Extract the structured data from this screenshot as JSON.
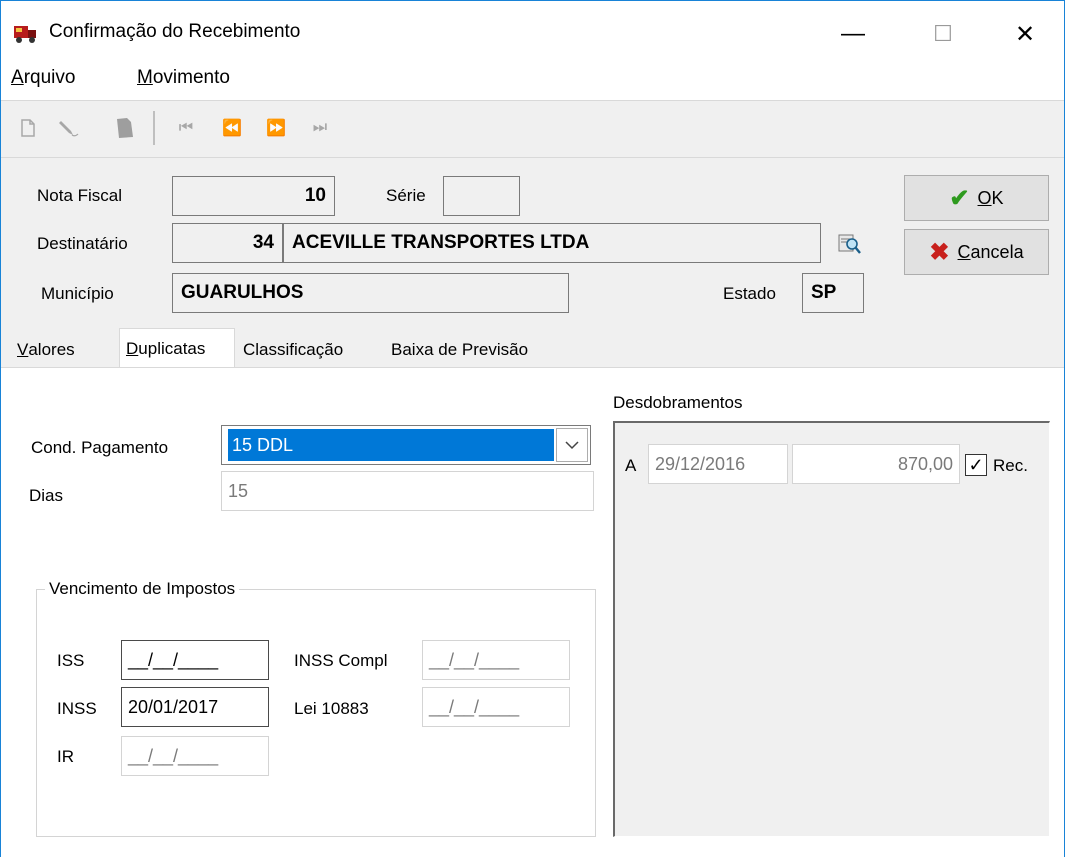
{
  "window": {
    "title": "Confirmação do Recebimento",
    "minimize": "—",
    "maximize": "☐",
    "close": "✕"
  },
  "menu": {
    "arquivo": {
      "ul": "A",
      "rest": "rquivo"
    },
    "movimento": {
      "ul": "M",
      "rest": "ovimento"
    }
  },
  "toolbar": {
    "icons": [
      "new-document-icon",
      "edit-pencil-icon",
      "delete-icon",
      "first-record-icon",
      "prev-record-icon",
      "next-record-icon",
      "last-record-icon"
    ],
    "first": "⏮",
    "prev": "⏪",
    "next": "⏩",
    "last": "⏭"
  },
  "header": {
    "nota_fiscal_label": "Nota Fiscal",
    "nota_fiscal_value": "10",
    "serie_label": "Série",
    "serie_value": "",
    "destinatario_label": "Destinatário",
    "destinatario_code": "34",
    "destinatario_name": "ACEVILLE TRANSPORTES LTDA",
    "municipio_label": "Município",
    "municipio_value": "GUARULHOS",
    "estado_label": "Estado",
    "estado_value": "SP"
  },
  "buttons": {
    "ok": {
      "ul": "O",
      "rest": "K",
      "icon": "✔"
    },
    "cancela": {
      "ul": "C",
      "rest": "ancela",
      "icon": "✖"
    }
  },
  "tabs": [
    {
      "ul": "V",
      "rest": "alores"
    },
    {
      "ul": "D",
      "rest": "uplicatas"
    },
    {
      "ul": "",
      "rest": "Classificação"
    },
    {
      "ul": "",
      "rest": "Baixa de Previsão"
    }
  ],
  "duplicatas": {
    "cond_pagamento_label": "Cond. Pagamento",
    "cond_pagamento_value": "15 DDL",
    "dias_label": "Dias",
    "dias_value": "15",
    "vencimento_title": "Vencimento de Impostos",
    "iss_label": "ISS",
    "iss_value": "__/__/____",
    "inss_label": "INSS",
    "inss_value": "20/01/2017",
    "ir_label": "IR",
    "ir_value": "__/__/____",
    "inss_compl_label": "INSS Compl",
    "inss_compl_value": "__/__/____",
    "lei_label": "Lei 10883",
    "lei_value": "__/__/____",
    "desdobramentos_title": "Desdobramentos",
    "desdobramento": {
      "parcela": "A",
      "data": "29/12/2016",
      "valor": "870,00",
      "rec_label": "Rec.",
      "rec_checked": true,
      "check_glyph": "✓"
    }
  },
  "colors": {
    "selection": "#0078d7",
    "ok_check": "#2e9a1e",
    "cancel_x": "#c8201c",
    "window_border": "#1883d7"
  }
}
